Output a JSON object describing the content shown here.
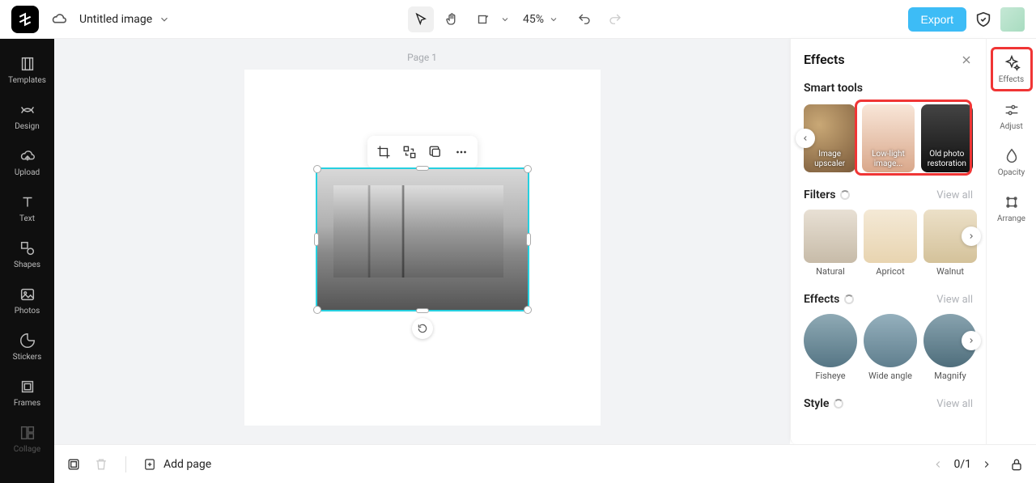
{
  "header": {
    "doc_title": "Untitled image",
    "zoom": "45%",
    "export": "Export"
  },
  "left_sidebar": {
    "items": [
      "Templates",
      "Design",
      "Upload",
      "Text",
      "Shapes",
      "Photos",
      "Stickers",
      "Frames",
      "Collage"
    ]
  },
  "canvas": {
    "page_label": "Page 1"
  },
  "effects_panel": {
    "title": "Effects",
    "smart_tools_label": "Smart tools",
    "smart_tools": [
      {
        "label": "Image upscaler"
      },
      {
        "label": "Low-light image..."
      },
      {
        "label": "Old photo restoration"
      }
    ],
    "filters_label": "Filters",
    "filters_view_all": "View all",
    "filters": [
      "Natural",
      "Apricot",
      "Walnut"
    ],
    "effects_label": "Effects",
    "effects_view_all": "View all",
    "effects": [
      "Fisheye",
      "Wide angle",
      "Magnify"
    ],
    "style_label": "Style",
    "style_view_all": "View all"
  },
  "right_strip": {
    "items": [
      "Effects",
      "Adjust",
      "Opacity",
      "Arrange"
    ]
  },
  "bottom_bar": {
    "add_page": "Add page",
    "page_counter": "0/1"
  }
}
